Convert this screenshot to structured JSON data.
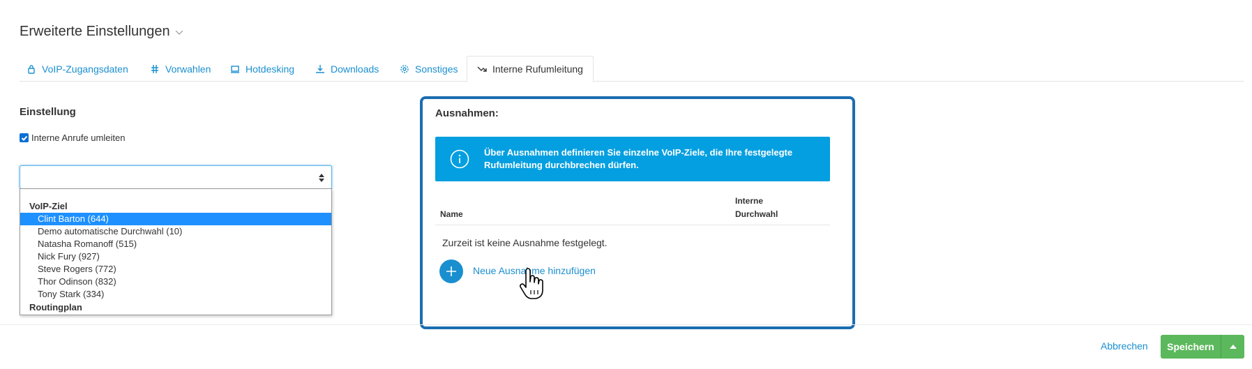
{
  "header": {
    "title": "Erweiterte Einstellungen"
  },
  "tabs": [
    {
      "label": "VoIP-Zugangsdaten",
      "icon": "lock-icon"
    },
    {
      "label": "Vorwahlen",
      "icon": "hash-icon"
    },
    {
      "label": "Hotdesking",
      "icon": "laptop-icon"
    },
    {
      "label": "Downloads",
      "icon": "download-icon"
    },
    {
      "label": "Sonstiges",
      "icon": "gear-icon"
    },
    {
      "label": "Interne Rufumleitung",
      "icon": "trend-arrow-icon",
      "active": true
    }
  ],
  "settings": {
    "title": "Einstellung",
    "checkbox_label": "Interne Anrufe umleiten",
    "checkbox_checked": true,
    "select_value": ""
  },
  "dropdown": {
    "group_voip": "VoIP-Ziel",
    "items": [
      "Clint Barton (644)",
      "Demo automatische Durchwahl (10)",
      "Natasha Romanoff (515)",
      "Nick Fury (927)",
      "Steve Rogers (772)",
      "Thor Odinson (832)",
      "Tony Stark (334)"
    ],
    "selected_index": 0,
    "group_routing": "Routingplan"
  },
  "exceptions": {
    "title": "Ausnahmen:",
    "info_text": "Über Ausnahmen definieren Sie einzelne VoIP-Ziele, die Ihre festgelegte Rufumleitung durchbrechen dürfen.",
    "col_name": "Name",
    "col_extension_line1": "Interne",
    "col_extension_line2": "Durchwahl",
    "empty_text": "Zurzeit ist keine Ausnahme festgelegt.",
    "add_label": "Neue Ausnahme hinzufügen"
  },
  "footer": {
    "cancel_label": "Abbrechen",
    "save_label": "Speichern"
  },
  "colors": {
    "accent": "#1a8fd0",
    "info_bg": "#049fe0",
    "card_border": "#1b6db0",
    "save_bg": "#5cb85c",
    "selected_bg": "#1e90ff"
  }
}
